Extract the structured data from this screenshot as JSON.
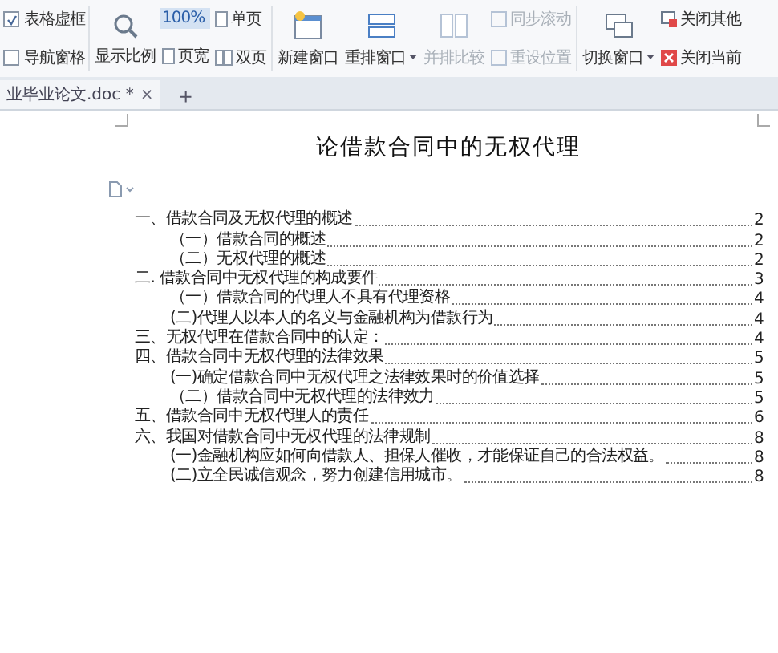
{
  "ribbon": {
    "view_options": [
      {
        "label": "表格虚框",
        "checked": true
      },
      {
        "label": "导航窗格",
        "checked": false
      }
    ],
    "zoom_button": {
      "label": "显示比例"
    },
    "zoom_value": {
      "label": "100%",
      "selected": true
    },
    "page_buttons": [
      {
        "label": "单页"
      },
      {
        "label": "页宽"
      },
      {
        "label": "双页"
      }
    ],
    "window_buttons": [
      {
        "label": "新建窗口",
        "kind": "new",
        "dropdown": false,
        "disabled": false
      },
      {
        "label": "重排窗口",
        "kind": "arrange",
        "dropdown": true,
        "disabled": false
      },
      {
        "label": "并排比较",
        "kind": "compare",
        "dropdown": false,
        "disabled": true
      }
    ],
    "sync_buttons": [
      {
        "label": "同步滚动",
        "disabled": true
      },
      {
        "label": "重设位置",
        "disabled": true
      }
    ],
    "switch_button": {
      "label": "切换窗口",
      "dropdown": true
    },
    "close_buttons": [
      {
        "label": "关闭其他",
        "kind": "others"
      },
      {
        "label": "关闭当前",
        "kind": "current"
      }
    ]
  },
  "tabs": [
    {
      "label": "业毕业论文.doc *",
      "close": "×",
      "selected": true
    }
  ],
  "new_tab": "+",
  "document": {
    "title": "论借款合同中的无权代理",
    "toc": [
      {
        "text": "一、借款合同及无权代理的概述",
        "page": "2",
        "children": [
          {
            "text": "（一）借款合同的概述",
            "page": "2"
          },
          {
            "text": "（二）无权代理的概述",
            "page": "2"
          }
        ]
      },
      {
        "text": "二. 借款合同中无权代理的构成要件",
        "page": "3",
        "children": [
          {
            "text": "（一）借款合同的代理人不具有代理资格",
            "page": "4"
          },
          {
            "text": "(二)代理人以本人的名义与金融机构为借款行为",
            "page": "4"
          }
        ]
      },
      {
        "text": "三、无权代理在借款合同中的认定：",
        "page": "4"
      },
      {
        "text": "四、借款合同中无权代理的法律效果",
        "page": "5",
        "children": [
          {
            "text": "(一)确定借款合同中无权代理之法律效果时的价值选择",
            "page": "5"
          },
          {
            "text": "（二）借款合同中无权代理的法律效力",
            "page": "5"
          }
        ]
      },
      {
        "text": "五、借款合同中无权代理人的责任",
        "page": "6"
      },
      {
        "text": "六、我国对借款合同中无权代理的法律规制",
        "page": "8",
        "children": [
          {
            "text": "(一)金融机构应如何向借款人、担保人催收，才能保证自己的合法权益。",
            "page": "8"
          },
          {
            "text": "(二)立全民诚信观念，努力创建信用城市。",
            "page": "8"
          }
        ]
      }
    ]
  }
}
